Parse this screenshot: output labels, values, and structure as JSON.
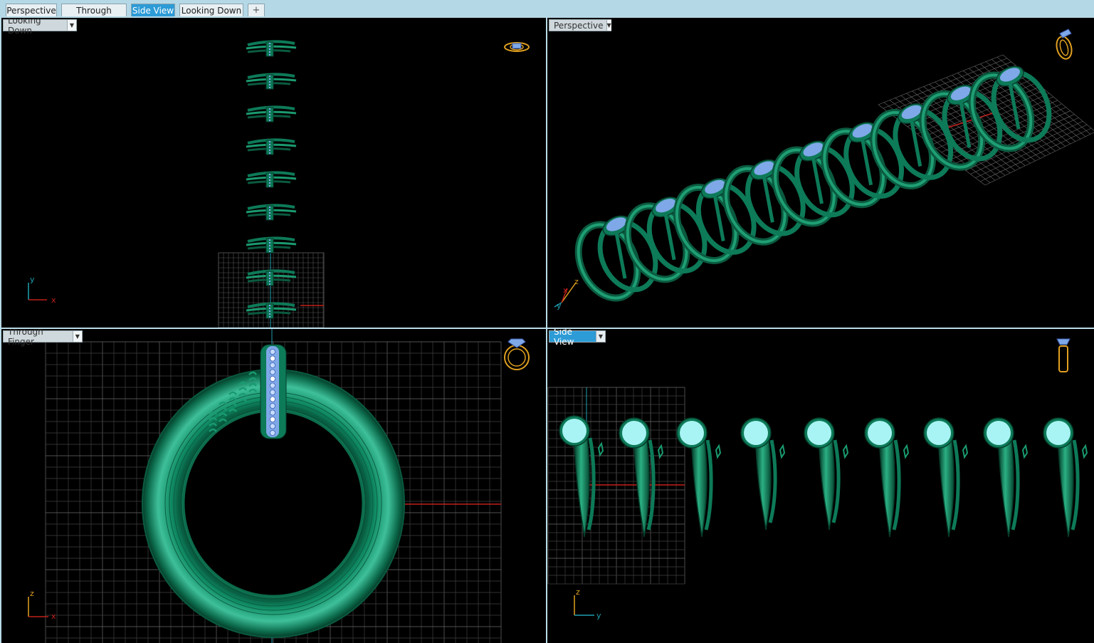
{
  "tabs": [
    {
      "label": "Perspective"
    },
    {
      "label": "Through Finger"
    },
    {
      "label": "Side View",
      "active": true
    },
    {
      "label": "Looking Down"
    },
    {
      "label": "+"
    }
  ],
  "viewports": {
    "top_left": {
      "title": "Looking Down",
      "axes": {
        "a": "y",
        "b": "x"
      }
    },
    "top_right": {
      "title": "Perspective",
      "axes": {
        "a": "z",
        "b": "x",
        "c": "y"
      }
    },
    "bottom_left": {
      "title": "Through Finger",
      "axes": {
        "a": "z",
        "b": "x"
      }
    },
    "bottom_right": {
      "title": "Side View",
      "active": true,
      "axes": {
        "a": "z",
        "b": "y"
      }
    }
  },
  "colors": {
    "ring_green": "#0d7a58",
    "gem_cyan": "#8fe8ea",
    "gem_blue": "#7fa8e8",
    "axis_red": "#c0201a",
    "axis_cyan": "#1fa0b0",
    "widget_orange": "#e0a020",
    "active_blue": "#2c9bd6"
  },
  "icons": [
    "dropdown-arrow-icon",
    "ring-orientation-icon",
    "add-viewport-icon"
  ]
}
